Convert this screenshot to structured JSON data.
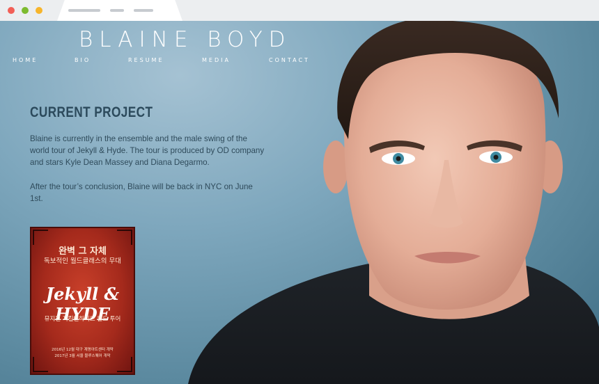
{
  "site": {
    "logo": "BLAINE BOYD",
    "nav": [
      "HOME",
      "BIO",
      "RESUME",
      "MEDIA",
      "CONTACT"
    ]
  },
  "current_project": {
    "title": "CURRENT PROJECT",
    "paragraph_1": "Blaine is currently in the ensemble and the male swing of the world tour of Jekyll & Hyde. The tour is produced by OD company and stars Kyle Dean Massey and Diana Degarmo.",
    "paragraph_2": "After the tour’s conclusion, Blaine will be back in NYC on June 1st."
  },
  "poster": {
    "line_1": "완벽 그 자체",
    "line_2": "독보적인 월드클래스의 무대",
    "logo": "Jekyll & HYDE",
    "line_3": "뮤지컬 지킬앤하이드 월드 투어",
    "line_4": "2016년 12월 대구 계명아트센터 개막",
    "line_5": "2017년 3월 서울 블루스퀘어 개막"
  },
  "colors": {
    "accent_text": "#2c4a5c",
    "background": "#7ea7bd",
    "poster_red": "#a52a1c"
  }
}
